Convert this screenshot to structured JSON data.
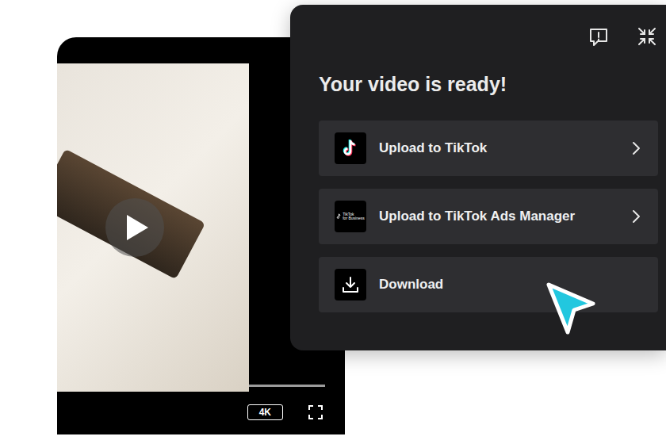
{
  "player": {
    "quality": "4K"
  },
  "panel": {
    "title": "Your video is ready!",
    "options": [
      {
        "kind": "tiktok",
        "label": "Upload to TikTok",
        "has_chevron": true
      },
      {
        "kind": "ads",
        "label": "Upload to TikTok Ads Manager",
        "has_chevron": true,
        "logo_lines": [
          "TikTok",
          "for Business"
        ]
      },
      {
        "kind": "download",
        "label": "Download",
        "has_chevron": false
      }
    ]
  }
}
